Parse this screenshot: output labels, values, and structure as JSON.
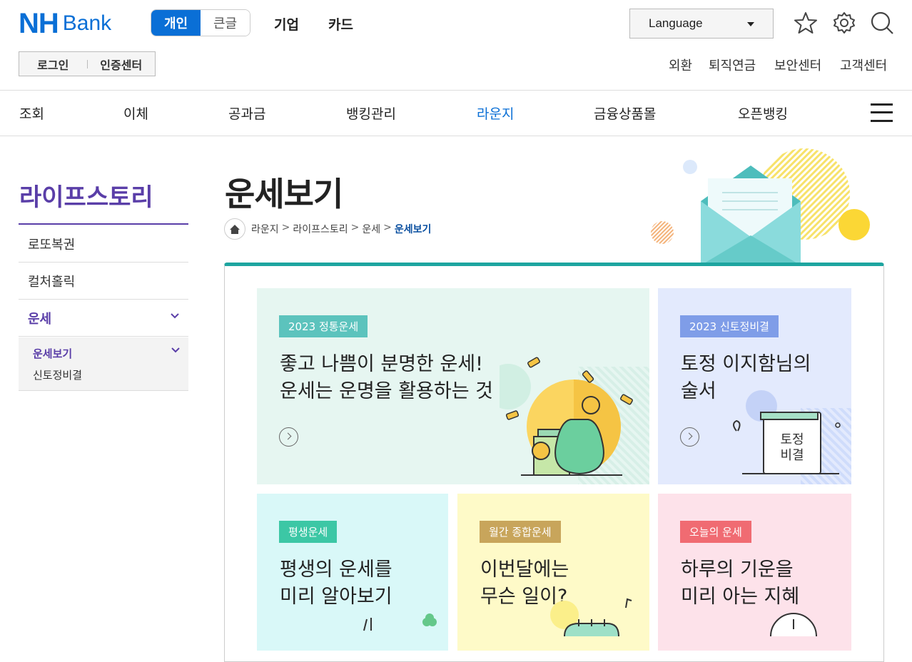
{
  "header": {
    "logo_main": "NH",
    "logo_sub": "Bank",
    "segment": [
      "개인",
      "큰글"
    ],
    "top_nav": [
      "기업",
      "카드"
    ],
    "language_label": "Language",
    "auth": [
      "로그인",
      "인증센터"
    ],
    "util_links": [
      "외환",
      "퇴직연금",
      "보안센터",
      "고객센터"
    ]
  },
  "gnb": [
    "조회",
    "이체",
    "공과금",
    "뱅킹관리",
    "라운지",
    "금융상품몰",
    "오픈뱅킹"
  ],
  "sidebar": {
    "title": "라이프스토리",
    "items": [
      "로또복권",
      "컬처홀릭",
      "운세"
    ],
    "sub_items": [
      "운세보기",
      "신토정비결"
    ]
  },
  "page": {
    "title": "운세보기",
    "breadcrumb": [
      "라운지",
      "라이프스토리",
      "운세",
      "운세보기"
    ]
  },
  "cards": [
    {
      "badge": "2023 정통운세",
      "line1": "좋고 나쁨이 분명한 운세!",
      "line2": "운세는 운명을 활용하는 것",
      "bg": "#e6f6f1",
      "badge_color": "#5cc3bd"
    },
    {
      "badge": "2023 신토정비결",
      "line1": "토정 이지함님의",
      "line2": "술서",
      "illu_text1": "토정",
      "illu_text2": "비결",
      "bg": "#e3eafd",
      "badge_color": "#7f9de8"
    },
    {
      "badge": "평생운세",
      "line1": "평생의 운세를",
      "line2": "미리 알아보기",
      "bg": "#d9f8f8",
      "badge_color": "#3cc7a5"
    },
    {
      "badge": "월간 종합운세",
      "line1": "이번달에는",
      "line2": "무슨 일이?",
      "bg": "#fefac8",
      "badge_color": "#c8a55b"
    },
    {
      "badge": "오늘의 운세",
      "line1": "하루의 기운을",
      "line2": "미리 아는 지혜",
      "bg": "#fde2ea",
      "badge_color": "#f06b72"
    }
  ]
}
